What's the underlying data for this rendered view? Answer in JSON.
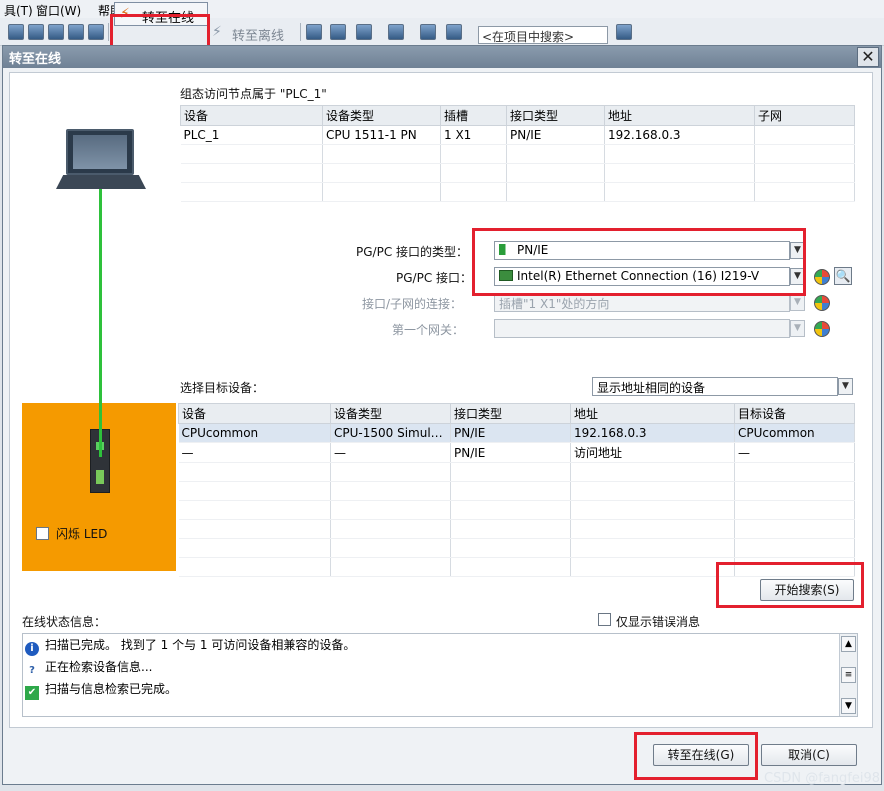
{
  "menubar": {
    "items": [
      "具(T)",
      "窗口(W)",
      "帮助(H)"
    ]
  },
  "toolbar": {
    "go_online_label": "转至在线",
    "go_offline_label": "转至离线",
    "search_placeholder": "<在项目中搜索>"
  },
  "dialog": {
    "title": "转至在线",
    "configured_node_title": "组态访问节点属于 \"PLC_1\"",
    "configured_table": {
      "headers": [
        "设备",
        "设备类型",
        "插槽",
        "接口类型",
        "地址",
        "子网"
      ],
      "rows": [
        [
          "PLC_1",
          "CPU 1511-1 PN",
          "1 X1",
          "PN/IE",
          "192.168.0.3",
          ""
        ]
      ]
    },
    "pgpc_type_label": "PG/PC 接口的类型：",
    "pgpc_type_value": "PN/IE",
    "pgpc_if_label": "PG/PC 接口：",
    "pgpc_if_value": "Intel(R) Ethernet Connection (16) I219-V",
    "subnet_conn_label": "接口/子网的连接：",
    "subnet_conn_value": "插槽\"1 X1\"处的方向",
    "gateway_label": "第一个网关：",
    "gateway_value": "",
    "select_target_label": "选择目标设备：",
    "show_filter_value": "显示地址相同的设备",
    "target_table": {
      "headers": [
        "设备",
        "设备类型",
        "接口类型",
        "地址",
        "目标设备"
      ],
      "rows": [
        [
          "CPUcommon",
          "CPU-1500 Simula...",
          "PN/IE",
          "192.168.0.3",
          "CPUcommon"
        ],
        [
          "—",
          "—",
          "PN/IE",
          "访问地址",
          "—"
        ]
      ]
    },
    "flash_led_label": "闪烁 LED",
    "start_search_label": "开始搜索(S)",
    "status_title": "在线状态信息：",
    "errors_only_label": "仅显示错误消息",
    "status_messages": [
      "扫描已完成。 找到了 1 个与 1 可访问设备相兼容的设备。",
      "正在检索设备信息...",
      "扫描与信息检索已完成。"
    ],
    "go_online_button": "转至在线(G)",
    "cancel_button": "取消(C)"
  },
  "watermark": "CSDN @fangfei98",
  "colors": {
    "highlight_red": "#e3202e",
    "orange": "#f59a00",
    "network_green": "#2ec13b"
  }
}
